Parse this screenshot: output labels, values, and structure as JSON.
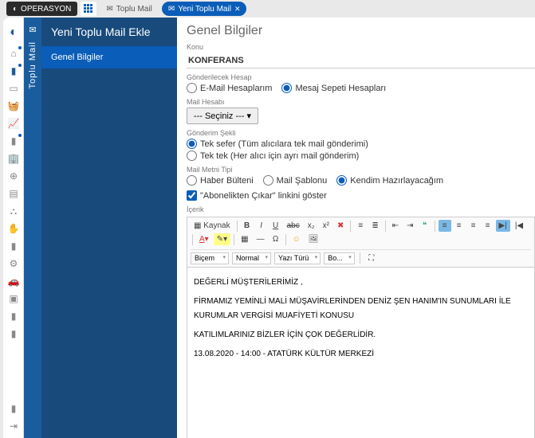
{
  "topbar": {
    "brand": "OPERASYON",
    "tabs": [
      {
        "label": "Toplu Mail",
        "active": false
      },
      {
        "label": "Yeni Toplu Mail",
        "active": true
      }
    ]
  },
  "sidepanel": {
    "vlabel": "Toplu Mail",
    "header": "Yeni Toplu Mail Ekle",
    "items": [
      "Genel Bilgiler"
    ]
  },
  "main": {
    "title": "Genel Bilgiler",
    "subject_label": "Konu",
    "subject_value": "KONFERANS",
    "account_label": "Gönderilecek Hesap",
    "account_options": [
      "E-Mail Hesaplarım",
      "Mesaj Sepeti Hesapları"
    ],
    "account_selected": 1,
    "mailacct_label": "Mail Hesabı",
    "mailacct_placeholder": "--- Seçiniz --- ▾",
    "sendtype_label": "Gönderim Şekli",
    "sendtype_options": [
      "Tek sefer (Tüm alıcılara tek mail gönderimi)",
      "Tek tek (Her alıcı için ayrı mail gönderim)"
    ],
    "sendtype_selected": 0,
    "bodytype_label": "Mail Metni Tipi",
    "bodytype_options": [
      "Haber Bülteni",
      "Mail Şablonu",
      "Kendim Hazırlayacağım"
    ],
    "bodytype_selected": 2,
    "unsubscribe_label": "\"Abonelikten Çıkar\" linkini göster",
    "content_label": "İçerik"
  },
  "editor": {
    "source": "Kaynak",
    "dropdowns": {
      "style": "Biçem",
      "format": "Normal",
      "font": "Yazı Türü",
      "size": "Bo..."
    },
    "body": [
      "DEĞERLİ MÜŞTERİLERİMİZ ,",
      "FİRMAMIZ YEMİNLİ MALİ MÜŞAVİRLERİNDEN DENİZ ŞEN HANIM'IN SUNUMLARI İLE KURUMLAR VERGİSİ MUAFİYETİ KONUSU",
      "KATILIMLARINIZ BİZLER İÇİN ÇOK DEĞERLİDİR.",
      "13.08.2020 - 14:00 - ATATÜRK KÜLTÜR MERKEZİ"
    ]
  }
}
